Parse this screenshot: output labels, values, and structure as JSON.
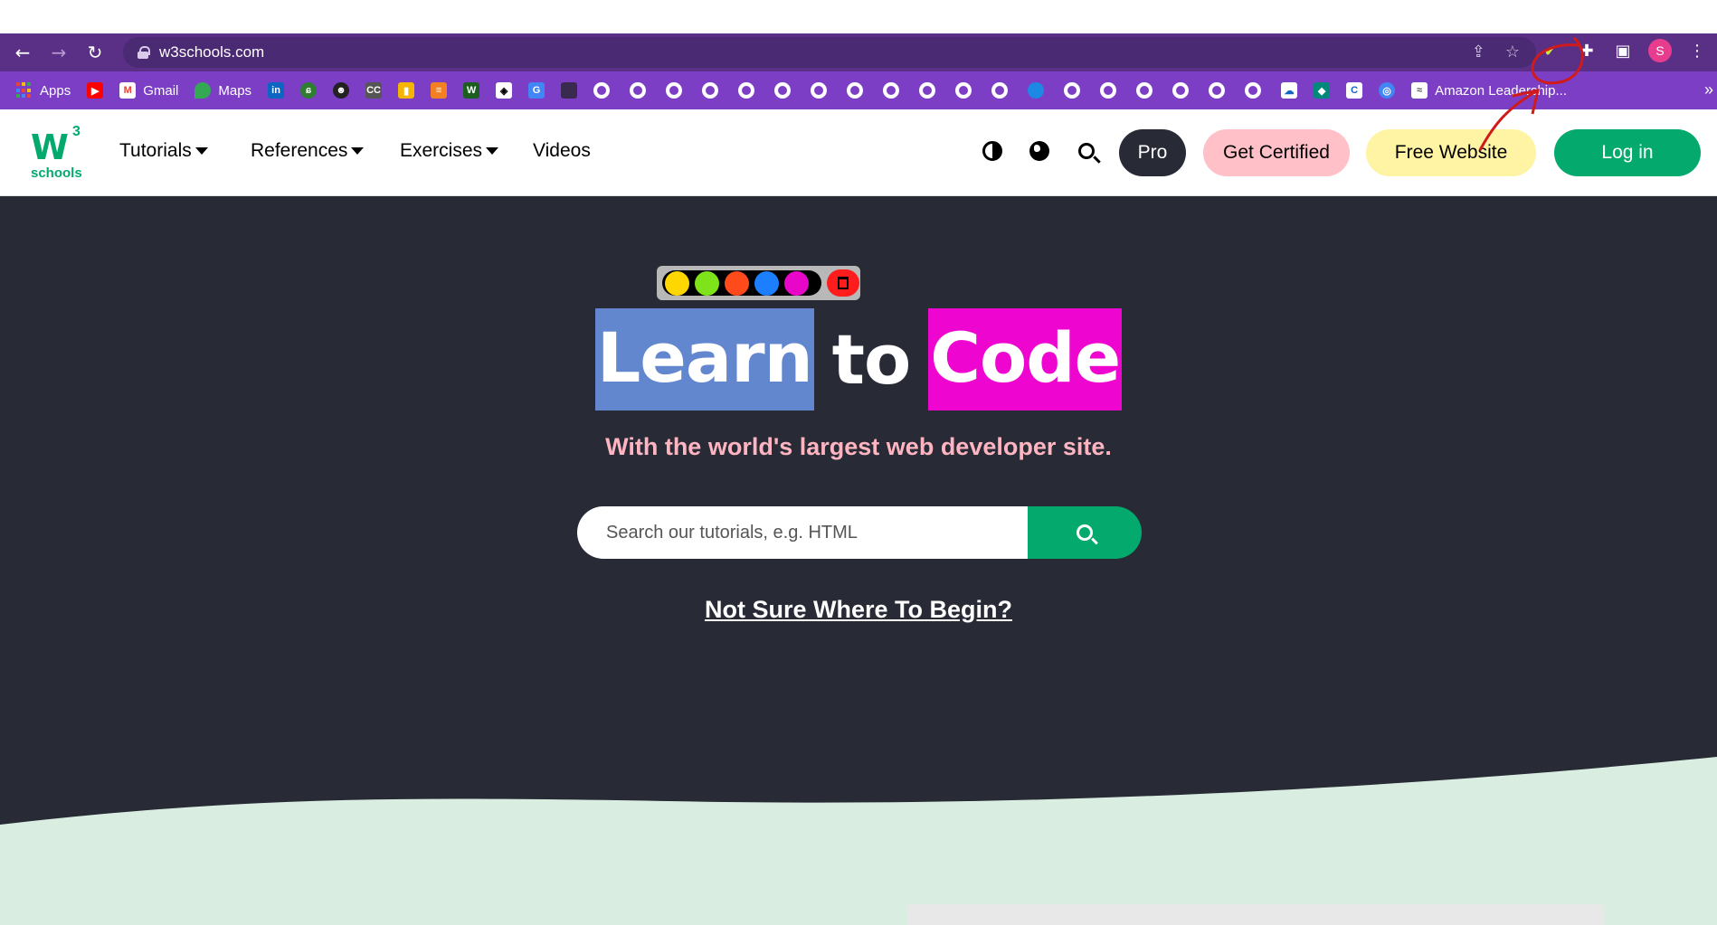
{
  "browser": {
    "url": "w3schools.com",
    "profile_initial": "S",
    "icons": [
      "back-arrow-icon",
      "forward-arrow-icon",
      "reload-icon",
      "share-icon",
      "star-icon",
      "extension-leaf-icon",
      "puzzle-icon",
      "side-panel-icon",
      "menu-dots-icon"
    ]
  },
  "bookmarks": {
    "named": [
      {
        "label": "Apps",
        "icon": "apps-grid-icon"
      },
      {
        "label": "Gmail",
        "icon": "gmail-icon"
      },
      {
        "label": "Maps",
        "icon": "maps-icon"
      }
    ],
    "last_label": "Amazon Leadership...",
    "overflow": "»"
  },
  "site_nav": {
    "logo_w": "W",
    "logo_3": "3",
    "logo_schools": "schools",
    "tutorials": "Tutorials",
    "references": "References",
    "exercises": "Exercises",
    "videos": "Videos",
    "pro": "Pro",
    "get_certified": "Get Certified",
    "free_website": "Free Website",
    "login": "Log in",
    "colors": {
      "green": "#04aa6d",
      "pro_bg": "#282a35",
      "cert_bg": "#ffc0c7",
      "free_bg": "#fff4a3"
    }
  },
  "hero": {
    "headline_learn": "Learn",
    "headline_to": "to",
    "headline_code": "Code",
    "subtitle": "With the world's largest web developer site.",
    "search_placeholder": "Search our tutorials, e.g. HTML",
    "begin_link": "Not Sure Where To Begin?",
    "palette_colors": [
      "#ffd700",
      "#7ee31a",
      "#ff4a1c",
      "#1c7fff",
      "#e807c8"
    ],
    "highlight_colors": {
      "learn": "#6387cf",
      "code": "#ee05d0"
    },
    "background": "#282a35",
    "wave_color": "#d9eee1"
  }
}
